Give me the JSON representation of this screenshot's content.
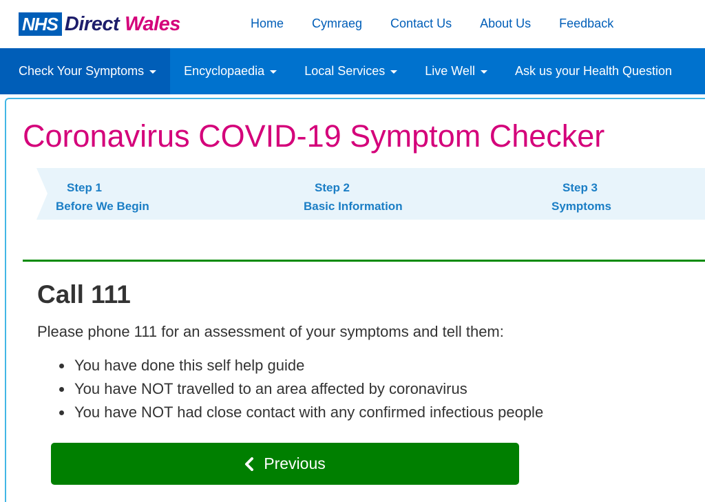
{
  "header": {
    "logo": {
      "nhs": "NHS",
      "direct": "Direct",
      "wales": "Wales"
    },
    "top_links": [
      "Home",
      "Cymraeg",
      "Contact Us",
      "About Us",
      "Feedback"
    ]
  },
  "mainnav": {
    "items": [
      {
        "label": "Check Your Symptoms",
        "dropdown": true,
        "active": true
      },
      {
        "label": "Encyclopaedia",
        "dropdown": true
      },
      {
        "label": "Local Services",
        "dropdown": true
      },
      {
        "label": "Live Well",
        "dropdown": true
      },
      {
        "label": "Ask us your Health Question",
        "dropdown": false
      }
    ]
  },
  "page": {
    "title": "Coronavirus COVID-19 Symptom Checker"
  },
  "steps": [
    {
      "num": "Step 1",
      "label": "Before We Begin"
    },
    {
      "num": "Step 2",
      "label": "Basic Information"
    },
    {
      "num": "Step 3",
      "label": "Symptoms"
    }
  ],
  "result": {
    "heading": "Call 111",
    "intro": "Please phone 111 for an assessment of your symptoms and tell them:",
    "points": [
      "You have done this self help guide",
      "You have NOT travelled to an area affected by coronavirus",
      "You have NOT had close contact with any confirmed infectious people"
    ]
  },
  "buttons": {
    "previous": "Previous",
    "previous_icon": "chevron-left-icon"
  },
  "colors": {
    "brand_blue": "#005eb8",
    "nav_blue": "#0072ce",
    "title_pink": "#d4007a",
    "success_green": "#007f00"
  }
}
